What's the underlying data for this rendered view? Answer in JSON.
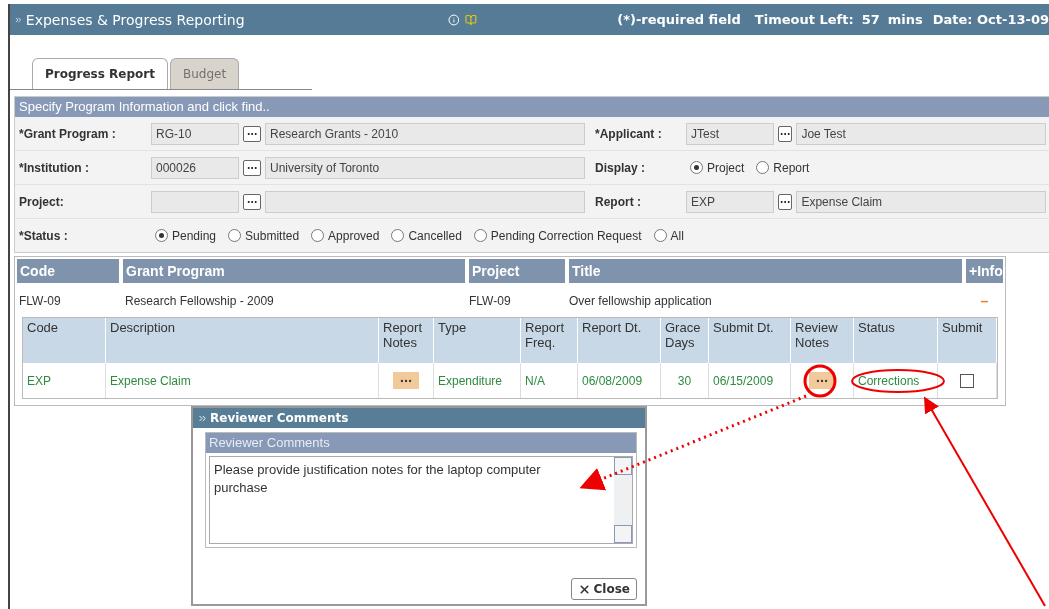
{
  "header": {
    "title": "Expenses & Progress Reporting",
    "required_note": "(*)-required field",
    "timeout_label": "Timeout Left:",
    "timeout_value": "57",
    "timeout_unit": "mins",
    "date": "Date: Oct-13-09"
  },
  "tabs": [
    {
      "label": "Progress Report",
      "selected": true
    },
    {
      "label": "Budget",
      "selected": false
    }
  ],
  "search_panel": {
    "title": "Specify Program Information and click find..",
    "rows": [
      {
        "left": {
          "kind": "lookup",
          "label": "*Grant Program :",
          "code": "RG-10",
          "name": "Research Grants - 2010"
        },
        "right": {
          "kind": "lookup",
          "label": "*Applicant :",
          "code": "JTest",
          "name": "Joe Test"
        }
      },
      {
        "left": {
          "kind": "lookup",
          "label": "*Institution :",
          "code": "000026",
          "name": "University of Toronto"
        },
        "right": {
          "kind": "radios",
          "label": "Display :",
          "options": [
            {
              "label": "Project",
              "selected": true
            },
            {
              "label": "Report",
              "selected": false
            }
          ]
        }
      },
      {
        "left": {
          "kind": "lookup",
          "label": "Project:"
        },
        "right": {
          "kind": "lookup",
          "label": "Report :",
          "code": "EXP",
          "name": "Expense Claim"
        }
      }
    ],
    "status": {
      "label": "*Status :",
      "options": [
        {
          "label": "Pending",
          "selected": true
        },
        {
          "label": "Submitted",
          "selected": false
        },
        {
          "label": "Approved",
          "selected": false
        },
        {
          "label": "Cancelled",
          "selected": false
        },
        {
          "label": "Pending Correction Request",
          "selected": false
        },
        {
          "label": "All",
          "selected": false
        }
      ]
    }
  },
  "results": {
    "columns": [
      "Code",
      "Grant Program",
      "Project",
      "Title",
      "+Info"
    ],
    "rows": [
      {
        "code": "FLW-09",
        "grant_program": "Research Fellowship - 2009",
        "project": "FLW-09",
        "title": "Over fellowship application",
        "info": "–",
        "reports": {
          "columns": [
            "Code",
            "Description",
            "Report Notes",
            "Type",
            "Report Freq.",
            "Report Dt.",
            "Grace Days",
            "Submit Dt.",
            "Review Notes",
            "Status",
            "Submit"
          ],
          "rows": [
            {
              "code": "EXP",
              "description": "Expense Claim",
              "type": "Expenditure",
              "frequency": "N/A",
              "report_date": "06/08/2009",
              "grace_days": "30",
              "submit_date": "06/15/2009",
              "status": "Corrections",
              "submit_checked": false
            }
          ]
        }
      }
    ]
  },
  "dialog": {
    "title": "Reviewer Comments",
    "section_title": "Reviewer Comments",
    "comment": "Please provide justification notes for the laptop computer purchase",
    "close_label": "Close"
  }
}
